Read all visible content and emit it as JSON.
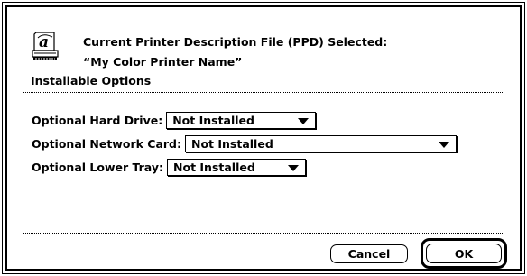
{
  "dialog": {
    "header_line1": "Current Printer Description File (PPD) Selected:",
    "header_line2": "“My Color Printer Name”",
    "section_label": "Installable Options"
  },
  "options": [
    {
      "label": "Optional Hard Drive:",
      "value": "Not Installed"
    },
    {
      "label": "Optional Network Card:",
      "value": "Not Installed"
    },
    {
      "label": "Optional Lower Tray:",
      "value": "Not Installed"
    }
  ],
  "buttons": {
    "cancel_label": "Cancel",
    "ok_label": "OK"
  },
  "icons": {
    "printer": "printer-document-icon"
  }
}
